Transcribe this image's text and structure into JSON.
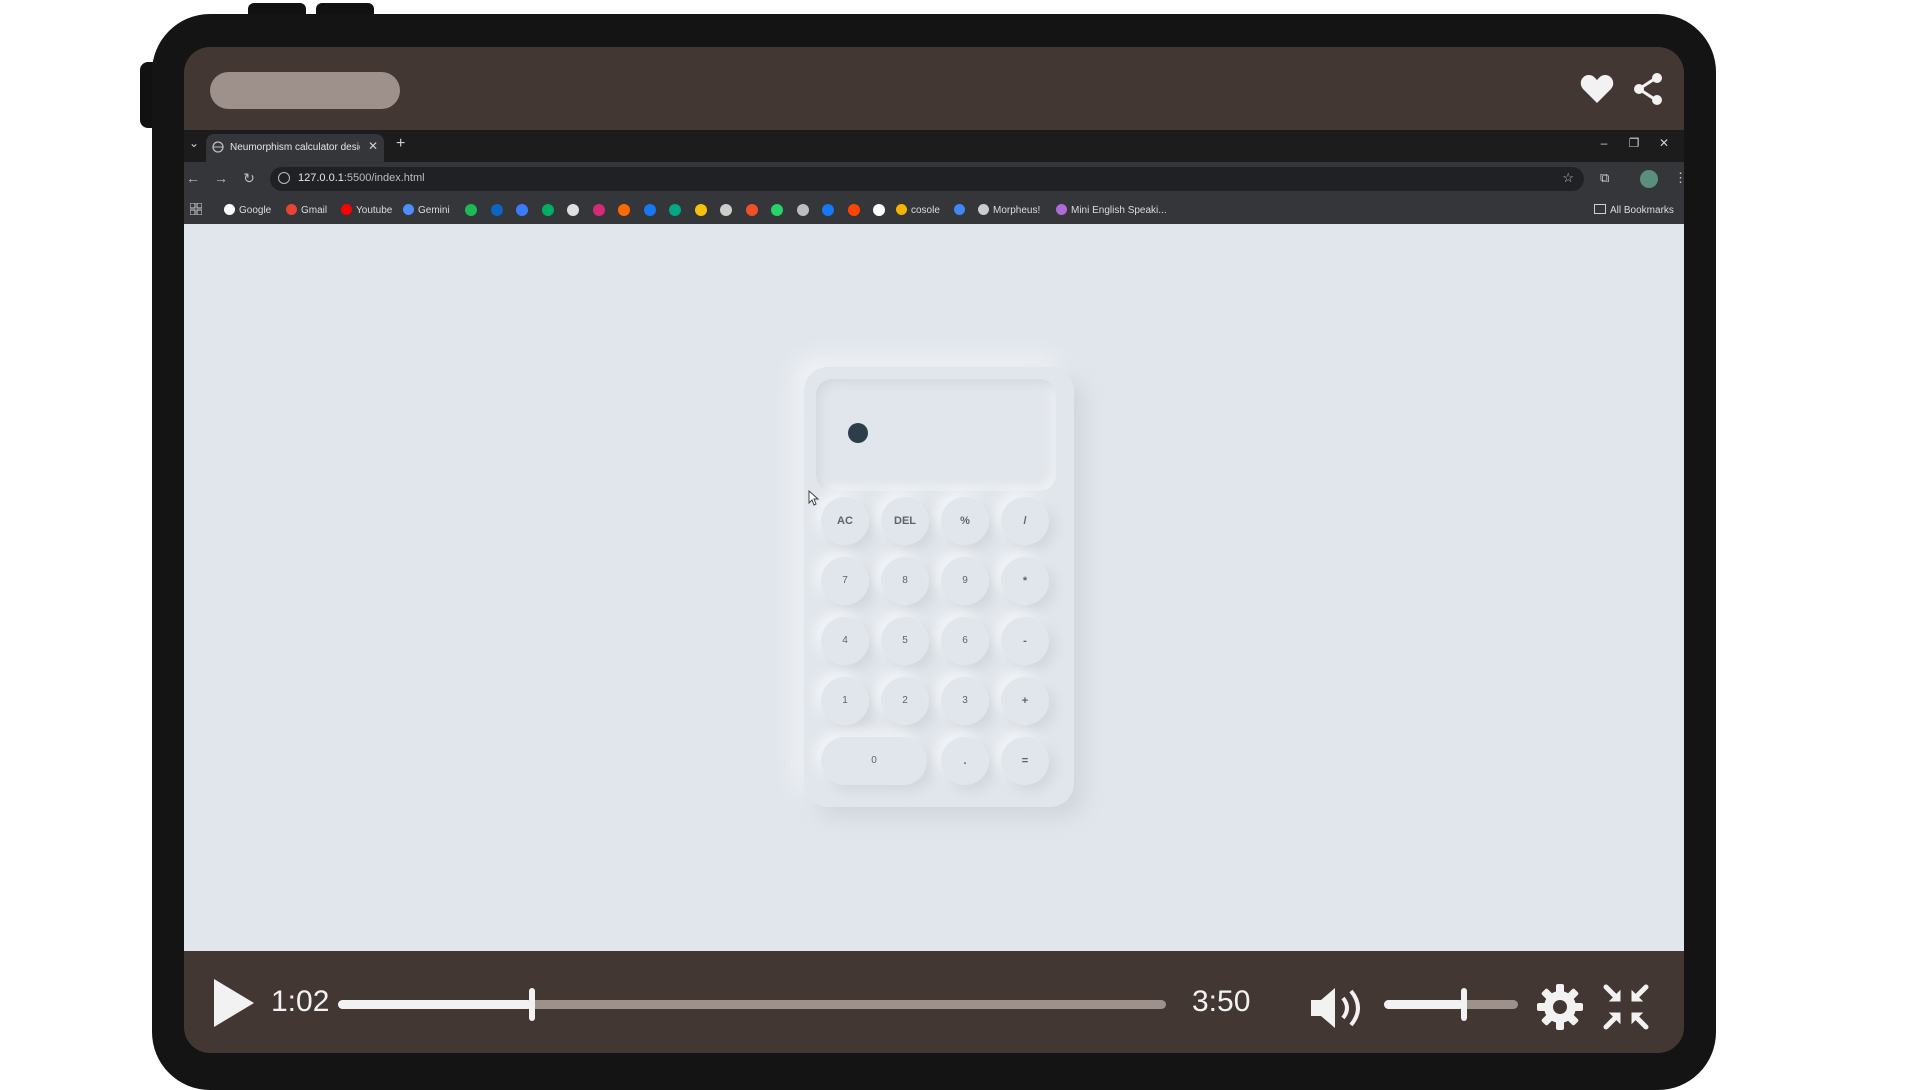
{
  "video_player": {
    "current_time": "1:02",
    "duration": "3:50",
    "progress_fraction": 0.234,
    "volume_fraction": 0.6,
    "icons": {
      "favorite": "heart-icon",
      "share": "share-icon",
      "play": "play-icon",
      "volume": "volume-icon",
      "settings": "gear-icon",
      "exit_fullscreen": "compress-icon"
    }
  },
  "browser": {
    "tab": {
      "title": "Neumorphism calculator design"
    },
    "url": {
      "host": "127.0.0.1",
      "path": ":5500/index.html"
    },
    "bookmarks": [
      {
        "label": "Google",
        "color": "#ffffff"
      },
      {
        "label": "Gmail",
        "color": "#ea4335"
      },
      {
        "label": "Youtube",
        "color": "#ff0000"
      },
      {
        "label": "Gemini",
        "color": "#4f8cff"
      }
    ],
    "bookmark_icon_colors": [
      "#1db954",
      "#0a66c2",
      "#3a7bfd",
      "#00b060",
      "#e0e0e0",
      "#d62976",
      "#ff6a00",
      "#1877f2",
      "#00a884",
      "#f4c20d",
      "#cccccc",
      "#f25022",
      "#25d366",
      "#bdbdbd",
      "#1877f2",
      "#ff4500",
      "#ffffff"
    ],
    "bookmarks_tail": [
      {
        "label": "cosole",
        "color": "#f4b400"
      },
      {
        "label": "",
        "color": "#4285f4"
      },
      {
        "label": "Morpheus!",
        "color": "#cccccc"
      },
      {
        "label": "Mini English Speaki...",
        "color": "#b06ad8"
      }
    ],
    "all_bookmarks": "All Bookmarks"
  },
  "calculator": {
    "rows": [
      [
        "AC",
        "DEL",
        "%",
        "/"
      ],
      [
        "7",
        "8",
        "9",
        "*"
      ],
      [
        "4",
        "5",
        "6",
        "-"
      ],
      [
        "1",
        "2",
        "3",
        "+"
      ],
      [
        "0",
        ".",
        "="
      ]
    ]
  }
}
